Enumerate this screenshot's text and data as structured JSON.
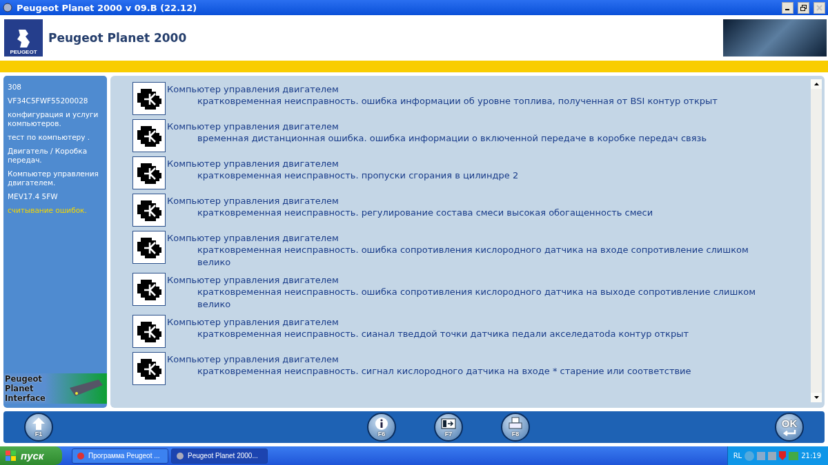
{
  "window": {
    "title": "Peugeot Planet 2000 v 09.B (22.12)"
  },
  "header": {
    "brand": "PEUGEOT",
    "title": "Peugeot Planet 2000"
  },
  "sidebar": {
    "items": [
      {
        "label": "308",
        "selected": false
      },
      {
        "label": "VF34C5FWF55200028",
        "selected": false
      },
      {
        "label": "конфигурация и услуги компьютеров.",
        "selected": false
      },
      {
        "label": "тест по компьютеру .",
        "selected": false
      },
      {
        "label": "Двигатель / Коробка передач.",
        "selected": false
      },
      {
        "label": "Компьютер управления двигателем.",
        "selected": false
      },
      {
        "label": "MEV17.4 5FW",
        "selected": false
      },
      {
        "label": "считывание ошибок.",
        "selected": true
      }
    ],
    "banner": "Peugeot Planet Interface"
  },
  "faults": [
    {
      "ecu": "Компьютер управления двигателем",
      "description": "кратковременная неисправность. ошибка информации об уровне топлива, полученная от BSI контур открыт"
    },
    {
      "ecu": "Компьютер управления двигателем",
      "description": "временная дистанционная ошибка. ошибка информации о включенной передаче в коробке передач связь"
    },
    {
      "ecu": "Компьютер управления двигателем",
      "description": "кратковременная неисправность. пропуски сгорания в цилиндре 2"
    },
    {
      "ecu": "Компьютер управления двигателем",
      "description": "кратковременная неисправность. регулирование состава смеси высокая обогащенность смеси"
    },
    {
      "ecu": "Компьютер управления двигателем",
      "description": "кратковременная неисправность. ошибка сопротивления кислородного датчика на входе сопротивление слишком велико"
    },
    {
      "ecu": "Компьютер управления двигателем",
      "description": "кратковременная неисправность. ошибка сопротивления кислородного датчика на выходе сопротивление слишком велико"
    },
    {
      "ecu": "Компьютер управления двигателем",
      "description": "кратковременная неисправность. сианал тведдой точки датчика педали акселедатoda контур открыт"
    },
    {
      "ecu": "Компьютер управления двигателем",
      "description": "кратковременная неисправность. сигнал кислородного датчика на входе * старение или соответствие"
    }
  ],
  "toolbar": [
    {
      "kind": "up",
      "key": "F1"
    },
    {
      "kind": "info",
      "key": "F6"
    },
    {
      "kind": "exit",
      "key": "F7"
    },
    {
      "kind": "print",
      "key": "F8"
    },
    {
      "kind": "ok",
      "key": "OK"
    }
  ],
  "taskbar": {
    "start": "пуск",
    "tasks": [
      {
        "label": "Программа Peugeot ...",
        "selected": false
      },
      {
        "label": "Peugeot Planet 2000...",
        "selected": true
      }
    ],
    "language": "RL",
    "clock": "21:19"
  }
}
